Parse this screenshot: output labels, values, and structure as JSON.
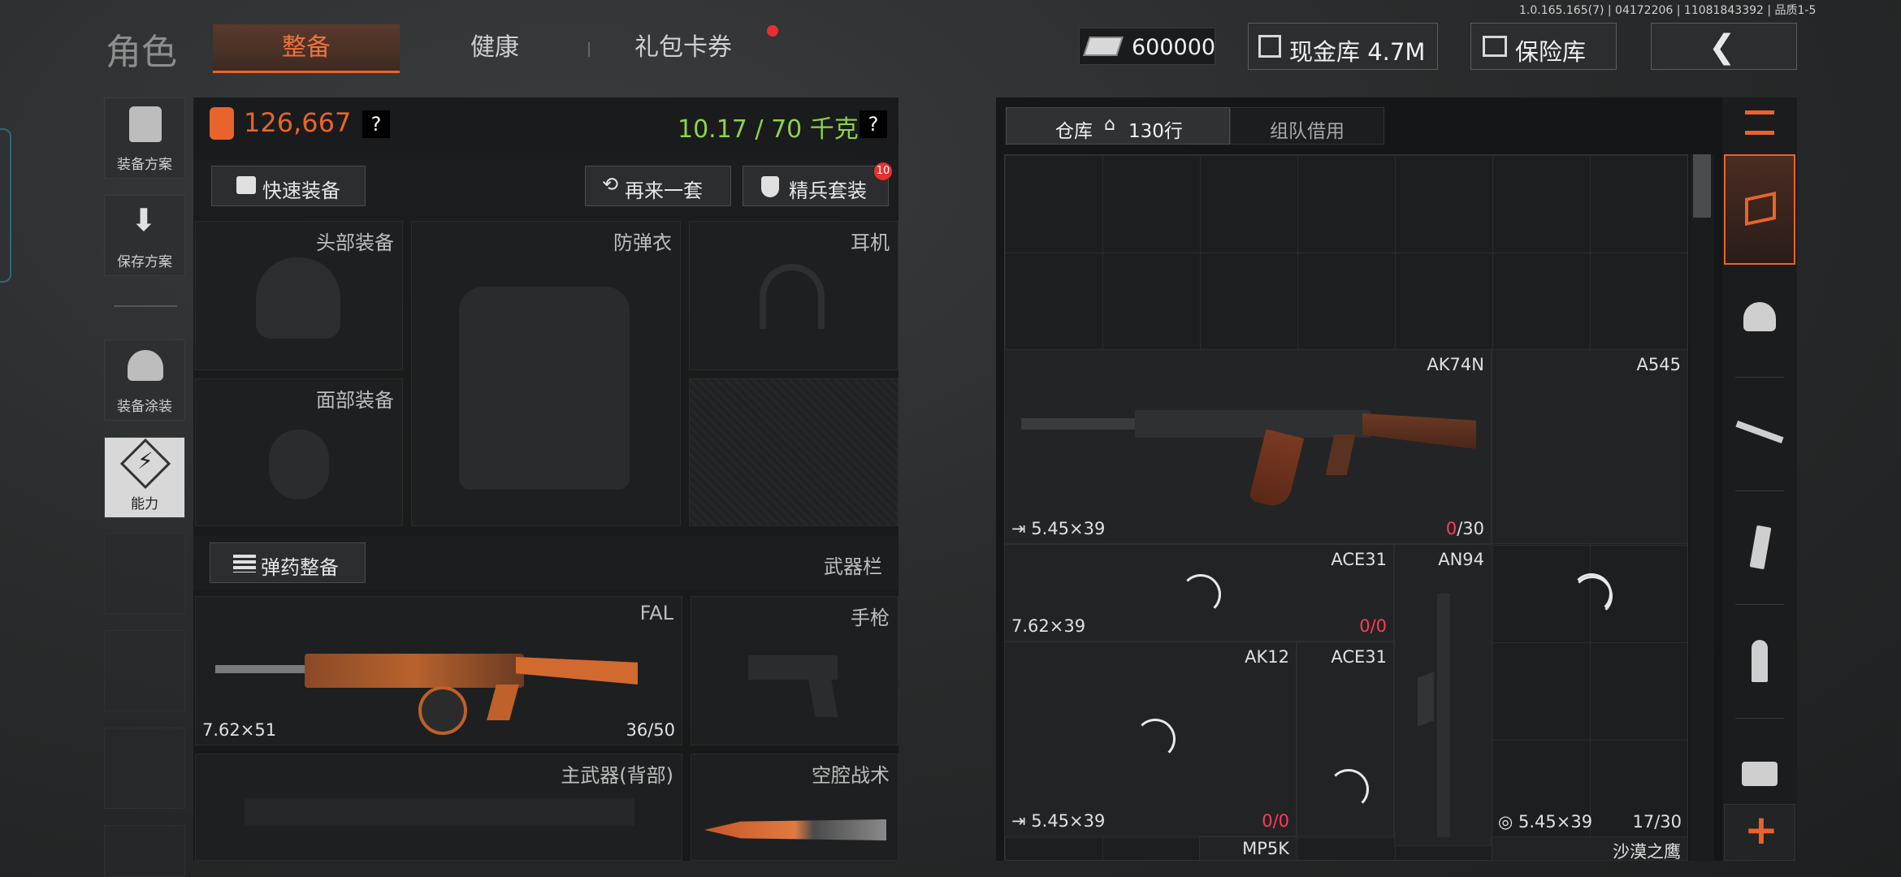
{
  "version_info": "1.0.165.165(7) | 04172206 | 11081843392 | 品质1-5",
  "header": {
    "section_title": "角色",
    "tabs": [
      {
        "label": "整备",
        "active": true
      },
      {
        "label": "健康",
        "active": false
      },
      {
        "label": "礼包卡券",
        "active": false,
        "notification": true
      }
    ],
    "currency_amount": "600000",
    "cash_vault_label": "现金库 4.7M",
    "insurance_label": "保险库"
  },
  "sidebar": {
    "loadout_plan": "装备方案",
    "save_plan": "保存方案",
    "equipment_skin": "装备涂装",
    "ability": "能力"
  },
  "loadout": {
    "value": "126,667",
    "weight": "10.17 / 70 千克",
    "help": "?",
    "quick_equip": "快速装备",
    "repeat_set": "再来一套",
    "elite_set": "精兵套装",
    "elite_badge": "10",
    "slots": {
      "head": "头部装备",
      "armor": "防弹衣",
      "headset": "耳机",
      "face": "面部装备"
    },
    "ammo_prep": "弹药整备",
    "weapon_bar": "武器栏",
    "primary": {
      "name": "FAL",
      "ammo": "7.62×51",
      "count": "36/50"
    },
    "pistol": "手枪",
    "back_weapon": "主武器(背部)",
    "melee": "空腔战术"
  },
  "storage": {
    "tab_warehouse": "仓库",
    "warehouse_rows": "130行",
    "tab_team": "组队借用",
    "items": [
      {
        "name": "AK74N",
        "ammo": "5.45×39",
        "count_current": "0",
        "count_total": "/30"
      },
      {
        "name": "A545"
      },
      {
        "name": "ACE31",
        "ammo": "7.62×39",
        "count_current": "0",
        "count_total": "/0"
      },
      {
        "name": "AN94"
      },
      {
        "name": "AK12",
        "ammo": "5.45×39",
        "count_current": "0",
        "count_total": "/0"
      },
      {
        "name": "ACE31"
      },
      {
        "name": "",
        "ammo": "5.45×39",
        "count": "17/30"
      },
      {
        "name": "MP5K"
      },
      {
        "name": "沙漠之鹰"
      }
    ]
  },
  "colors": {
    "accent_orange": "#e8642c",
    "weight_green": "#8fd14f",
    "count_red": "#ff3b5c"
  }
}
